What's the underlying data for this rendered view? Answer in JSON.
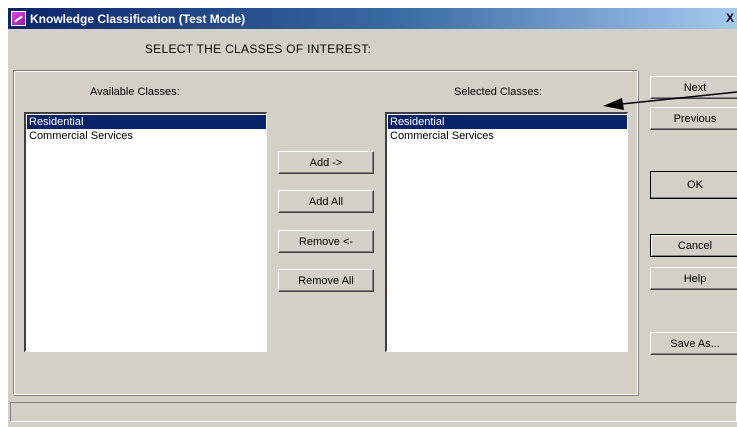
{
  "window": {
    "title": "Knowledge Classification (Test Mode)",
    "close_glyph": "X"
  },
  "heading": "SELECT THE CLASSES OF INTEREST:",
  "available": {
    "label": "Available Classes:",
    "items": [
      {
        "label": "Residential",
        "selected": true
      },
      {
        "label": "Commercial Services",
        "selected": false
      }
    ]
  },
  "selected": {
    "label": "Selected Classes:",
    "items": [
      {
        "label": "Residential",
        "selected": true
      },
      {
        "label": "Commercial Services",
        "selected": false
      }
    ]
  },
  "transfer_buttons": {
    "add": "Add ->",
    "add_all": "Add All",
    "remove": "Remove <-",
    "remove_all": "Remove All"
  },
  "side_buttons": {
    "next": "Next",
    "previous": "Previous",
    "ok": "OK",
    "cancel": "Cancel",
    "help": "Help",
    "save_as": "Save As..."
  },
  "colors": {
    "selection": "#0a246a",
    "face": "#d4d0c8",
    "title_start": "#0a246a"
  },
  "icons": {
    "app": "knowledge-classifier-icon",
    "close": "close-icon",
    "pointer": "annotation-arrow"
  }
}
